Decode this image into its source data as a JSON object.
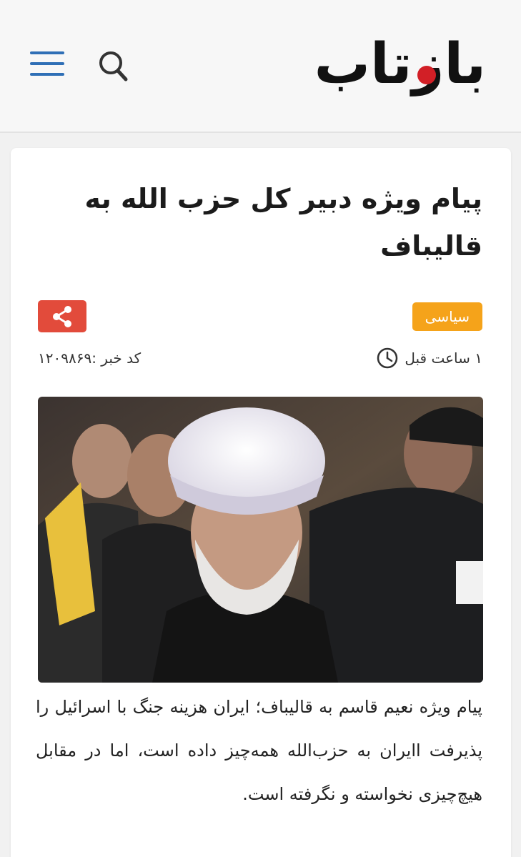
{
  "header": {
    "logo_text": "باز‌تاب",
    "menu_icon": "hamburger-menu-icon",
    "search_icon": "search-icon",
    "accent_color": "#2f6fb6",
    "logo_dot_color": "#d21f26"
  },
  "article": {
    "title": "پیام ویژه دبیر کل حزب الله به قالیباف",
    "category": "سیاسی",
    "category_color": "#f5a31a",
    "share_icon": "share-icon",
    "share_color": "#e24b3b",
    "time_icon": "clock-icon",
    "time": "۱ ساعت قبل",
    "news_code": "کد خبر :۱۲۰۹۸۶۹",
    "lead": "پیام ویژه نعیم قاسم به قالیباف؛ ایران هزینه جنگ با اسرائیل را پذیرفت اایران به حزب‌الله همه‌چیز داده است، اما در مقابل هیچ‌چیزی نخواسته و نگرفته است."
  }
}
